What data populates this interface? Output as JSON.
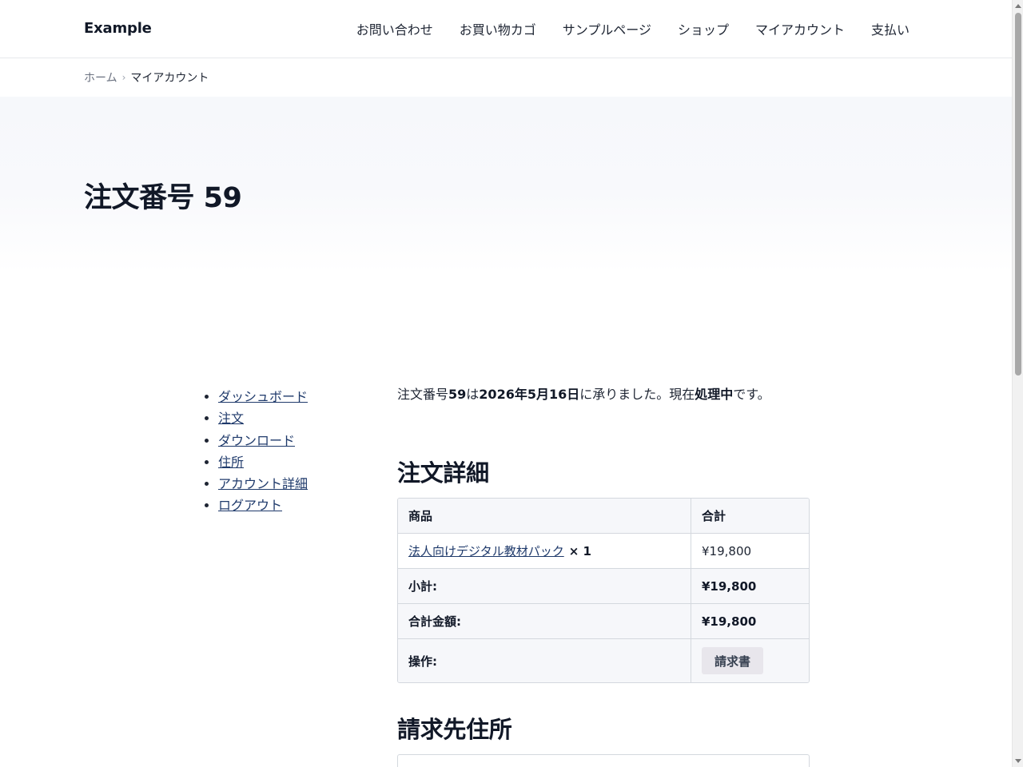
{
  "header": {
    "brand": "Example",
    "nav": [
      "お問い合わせ",
      "お買い物カゴ",
      "サンプルページ",
      "ショップ",
      "マイアカウント",
      "支払い"
    ]
  },
  "breadcrumb": {
    "home": "ホーム",
    "separator": "›",
    "current": "マイアカウント"
  },
  "page": {
    "title": "注文番号 59"
  },
  "account_nav": [
    "ダッシュボード",
    "注文",
    "ダウンロード",
    "住所",
    "アカウント詳細",
    "ログアウト"
  ],
  "order": {
    "summary_parts": {
      "p1": "注文番号",
      "order_number": "59",
      "p2": "は",
      "date": "2026年5月16日",
      "p3": "に承りました。現在",
      "status": "処理中",
      "p4": "です。"
    },
    "details_title": "注文詳細",
    "table": {
      "col_product": "商品",
      "col_total": "合計",
      "item_name": "法人向けデジタル教材パック",
      "item_qty": "× 1",
      "item_total": "¥19,800",
      "subtotal_label": "小計:",
      "subtotal_value": "¥19,800",
      "grand_total_label": "合計金額:",
      "grand_total_value": "¥19,800",
      "actions_label": "操作:",
      "invoice_button": "請求書"
    },
    "billing_title": "請求先住所"
  },
  "colors": {
    "link": "#1f3a6b",
    "text": "#1e2533",
    "table_head_bg": "#f6f7fa",
    "border": "#d4d8de",
    "button_bg": "#e8e6ec"
  }
}
